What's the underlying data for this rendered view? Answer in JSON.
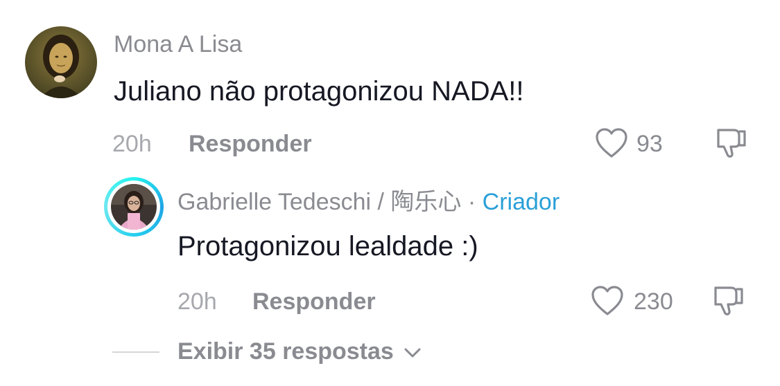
{
  "comment": {
    "username": "Mona A Lisa",
    "text": "Juliano não protagonizou NADA!!",
    "time": "20h",
    "reply_label": "Responder",
    "like_count": "93"
  },
  "reply": {
    "username": "Gabrielle Tedeschi / 陶乐心",
    "separator": " · ",
    "badge": "Criador",
    "text": "Protagonizou lealdade :)",
    "time": "20h",
    "reply_label": "Responder",
    "like_count": "230"
  },
  "view_replies": {
    "label": "Exibir 35 respostas"
  },
  "colors": {
    "accent": "#2aa0d8",
    "muted_text": "#8a8b91",
    "primary_text": "#161823"
  },
  "icons": [
    "heart-outline-icon",
    "dislike-icon",
    "chevron-down-icon"
  ]
}
